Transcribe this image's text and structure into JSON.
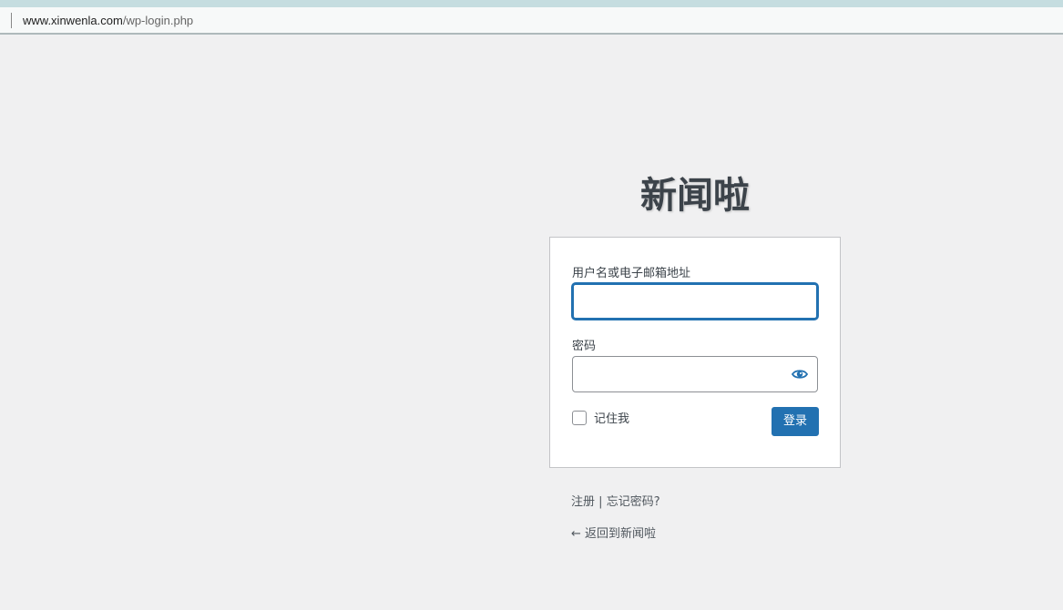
{
  "browser": {
    "url_host": "www.xinwenla.com",
    "url_path": "/wp-login.php"
  },
  "site": {
    "name": "新闻啦"
  },
  "form": {
    "username_label": "用户名或电子邮箱地址",
    "username_value": "",
    "password_label": "密码",
    "password_value": "",
    "remember_label": "记住我",
    "submit_label": "登录",
    "show_password_icon": "eye-icon"
  },
  "nav": {
    "register": "注册",
    "separator": "|",
    "lost_password": "忘记密码?"
  },
  "back": {
    "arrow": "←",
    "label": "返回到新闻啦"
  },
  "colors": {
    "primary": "#2271b1",
    "background": "#f0f0f1",
    "text": "#3c434a"
  }
}
